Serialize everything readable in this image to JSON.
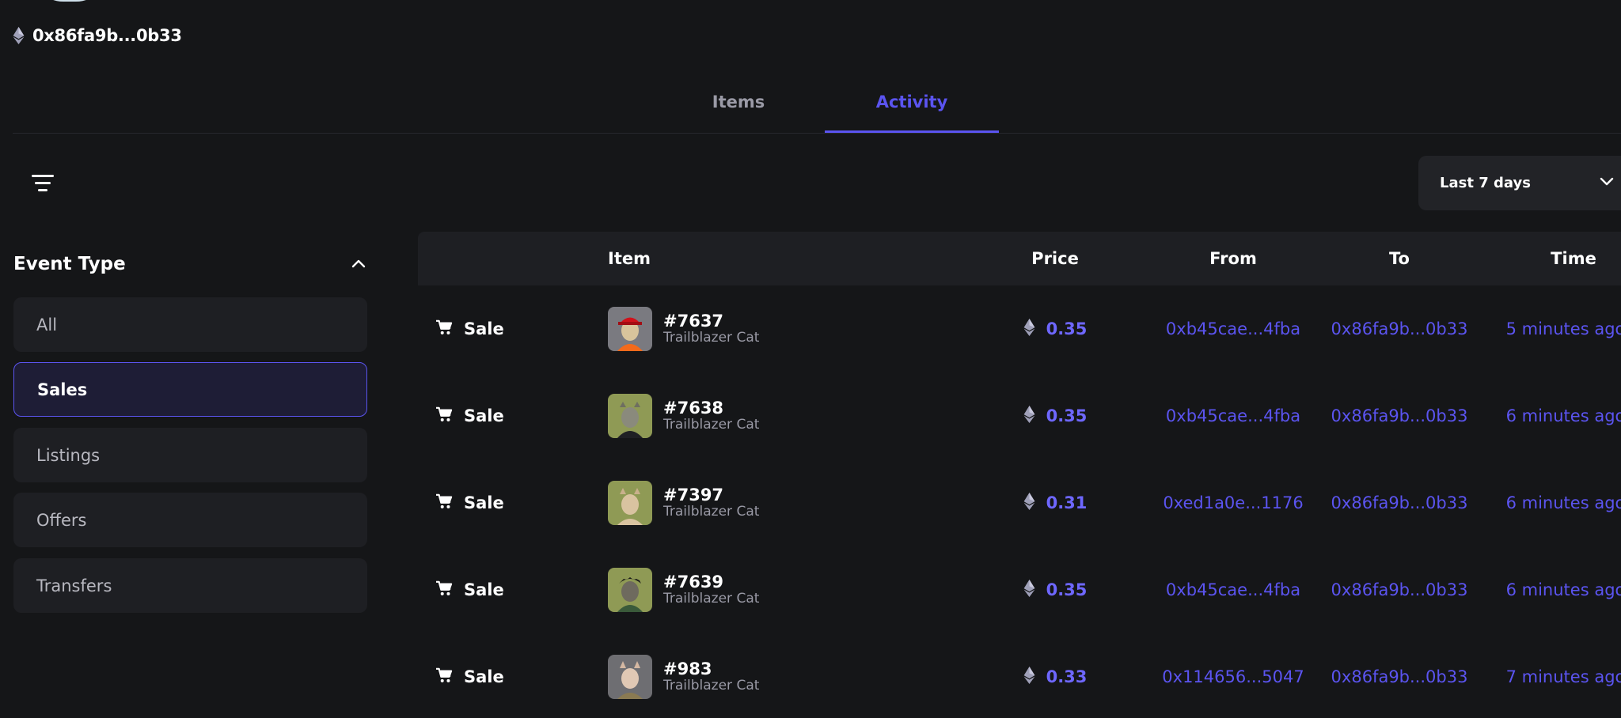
{
  "profile": {
    "address": "0x86fa9b...0b33"
  },
  "tabs": [
    {
      "label": "Items",
      "active": false
    },
    {
      "label": "Activity",
      "active": true
    }
  ],
  "filters": {
    "time_range": "Last 7 days"
  },
  "sidebar": {
    "title": "Event Type",
    "items": [
      {
        "label": "All",
        "selected": false
      },
      {
        "label": "Sales",
        "selected": true
      },
      {
        "label": "Listings",
        "selected": false
      },
      {
        "label": "Offers",
        "selected": false
      },
      {
        "label": "Transfers",
        "selected": false
      }
    ]
  },
  "table": {
    "columns": [
      "Item",
      "Price",
      "From",
      "To",
      "Time"
    ],
    "rows": [
      {
        "event": "Sale",
        "id": "#7637",
        "collection": "Trailblazer Cat",
        "price": "0.35",
        "from": "0xb45cae...4fba",
        "to": "0x86fa9b...0b33",
        "time": "5 minutes ago"
      },
      {
        "event": "Sale",
        "id": "#7638",
        "collection": "Trailblazer Cat",
        "price": "0.35",
        "from": "0xb45cae...4fba",
        "to": "0x86fa9b...0b33",
        "time": "6 minutes ago"
      },
      {
        "event": "Sale",
        "id": "#7397",
        "collection": "Trailblazer Cat",
        "price": "0.31",
        "from": "0xed1a0e...1176",
        "to": "0x86fa9b...0b33",
        "time": "6 minutes ago"
      },
      {
        "event": "Sale",
        "id": "#7639",
        "collection": "Trailblazer Cat",
        "price": "0.35",
        "from": "0xb45cae...4fba",
        "to": "0x86fa9b...0b33",
        "time": "6 minutes ago"
      },
      {
        "event": "Sale",
        "id": "#983",
        "collection": "Trailblazer Cat",
        "price": "0.33",
        "from": "0x114656...5047",
        "to": "0x86fa9b...0b33",
        "time": "7 minutes ago"
      }
    ]
  },
  "colors": {
    "background": "#151618",
    "accent": "#5b54f0",
    "panel": "#1e1f23"
  },
  "icons": {
    "currency": "ethereum-icon",
    "event": "cart-icon",
    "external": "external-link-icon",
    "filter": "filter-lines-icon"
  }
}
